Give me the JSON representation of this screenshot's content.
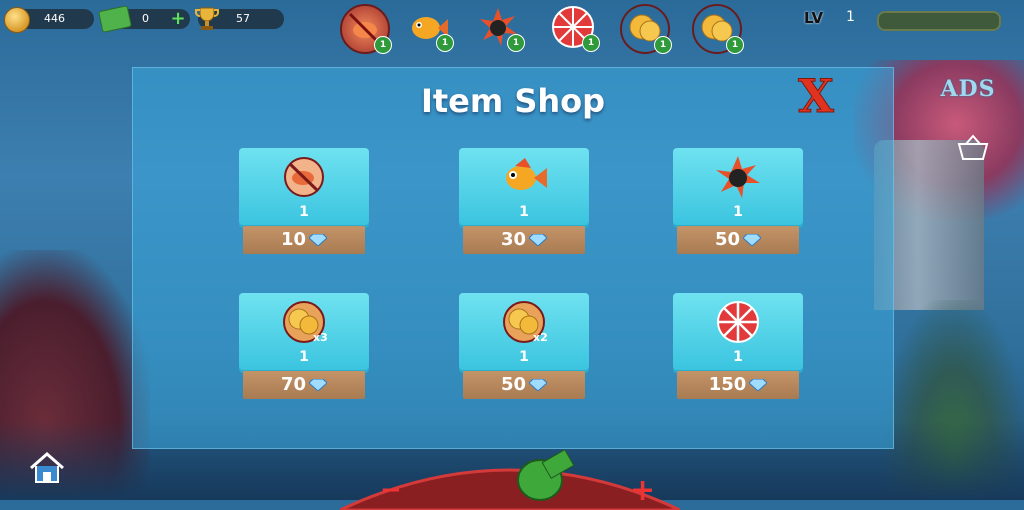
{
  "hud": {
    "coins": "446",
    "cash": "0",
    "trophy": "57",
    "level_label": "LV",
    "level_value": "1"
  },
  "powerup_slots": [
    {
      "icon": "no-fish-icon",
      "count": "1"
    },
    {
      "icon": "golden-fish-icon",
      "count": "1"
    },
    {
      "icon": "bomb-icon",
      "count": "1"
    },
    {
      "icon": "wheel-icon",
      "count": "1"
    },
    {
      "icon": "coin-x2-icon",
      "count": "1"
    },
    {
      "icon": "coin-x3-icon",
      "count": "1"
    }
  ],
  "shop": {
    "title": "Item Shop",
    "close_label": "X",
    "ads_label": "ADS",
    "items": [
      {
        "icon": "no-fish-icon",
        "quantity": "1",
        "price": "10"
      },
      {
        "icon": "golden-fish-icon",
        "quantity": "1",
        "price": "30"
      },
      {
        "icon": "bomb-icon",
        "quantity": "1",
        "price": "50"
      },
      {
        "icon": "coin-x3-icon",
        "quantity": "1",
        "price": "70",
        "multiplier": "x3"
      },
      {
        "icon": "coin-x2-icon",
        "quantity": "1",
        "price": "50",
        "multiplier": "x2"
      },
      {
        "icon": "wheel-icon",
        "quantity": "1",
        "price": "150"
      }
    ]
  },
  "bottom": {
    "minus": "−",
    "plus": "+"
  },
  "colors": {
    "panel": "#3aa8dc",
    "card": "#4fd3e8",
    "price_bar": "#b5865c",
    "close_x": "#e0321e",
    "badge": "#2e9a3a"
  }
}
